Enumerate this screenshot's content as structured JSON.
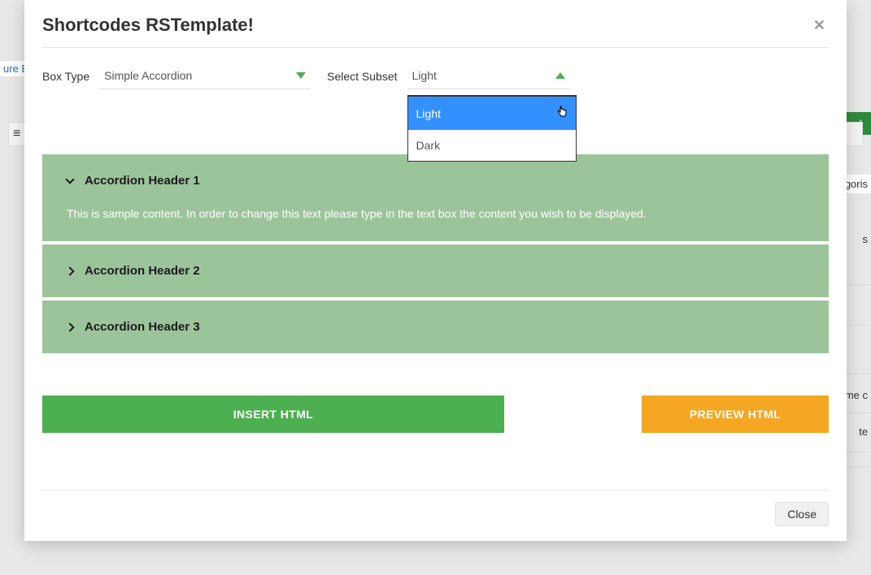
{
  "modal": {
    "title": "Shortcodes RSTemplate!",
    "box_type_label": "Box Type",
    "box_type_value": "Simple Accordion",
    "subset_label": "Select Subset",
    "subset_value": "Light",
    "subset_options": [
      "Light",
      "Dark"
    ]
  },
  "accordion": {
    "items": [
      {
        "title": "Accordion Header 1",
        "open": true,
        "content": "This is sample content. In order to change this text please type in the text box the content you wish to be displayed."
      },
      {
        "title": "Accordion Header 2",
        "open": false,
        "content": ""
      },
      {
        "title": "Accordion Header 3",
        "open": false,
        "content": ""
      }
    ]
  },
  "buttons": {
    "insert": "INSERT HTML",
    "preview": "PREVIEW HTML",
    "close": "Close"
  },
  "background": {
    "ure": "ure E",
    "d": "d",
    "gori": "goris",
    "s": "s",
    "me": "me c",
    "te": "te"
  }
}
